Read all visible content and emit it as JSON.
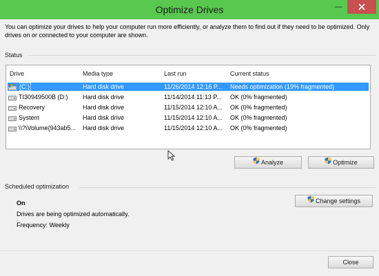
{
  "window": {
    "title": "Optimize Drives",
    "minimize_glyph": "—",
    "close_icon": "close-icon"
  },
  "intro": "You can optimize your drives to help your computer run more efficiently, or analyze them to find out if they need to be optimized. Only drives on or connected to your computer are shown.",
  "status": {
    "label": "Status",
    "columns": [
      "Drive",
      "Media type",
      "Last run",
      "Current status"
    ],
    "rows": [
      {
        "drive": "(C:)",
        "media": "Hard disk drive",
        "last_run": "11/26/2014 12:16 P...",
        "status": "Needs optimization (19% fragmented)",
        "selected": true,
        "icon": "windows-drive-icon"
      },
      {
        "drive": "TI30949500B (D:)",
        "media": "Hard disk drive",
        "last_run": "11/14/2014 11:13 P...",
        "status": "OK (0% fragmented)",
        "selected": false,
        "icon": "hard-drive-icon"
      },
      {
        "drive": "Recovery",
        "media": "Hard disk drive",
        "last_run": "11/15/2014 12:10 A...",
        "status": "OK (0% fragmented)",
        "selected": false,
        "icon": "hard-drive-icon"
      },
      {
        "drive": "System",
        "media": "Hard disk drive",
        "last_run": "11/15/2014 12:10 A...",
        "status": "OK (0% fragmented)",
        "selected": false,
        "icon": "hard-drive-icon"
      },
      {
        "drive": "\\\\?\\Volume{943ab5...",
        "media": "Hard disk drive",
        "last_run": "11/15/2014 12:10 A...",
        "status": "OK (0% fragmented)",
        "selected": false,
        "icon": "hard-drive-icon"
      }
    ],
    "analyze_label": "Analyze",
    "optimize_label": "Optimize"
  },
  "scheduled": {
    "label": "Scheduled optimization",
    "state": "On",
    "description": "Drives are being optimized automatically.",
    "frequency": "Frequency: Weekly",
    "change_settings_label": "Change settings"
  },
  "footer": {
    "close_label": "Close"
  },
  "colors": {
    "titlebar": "#58c84e",
    "selection": "#3399ff",
    "close_button": "#c75050"
  }
}
